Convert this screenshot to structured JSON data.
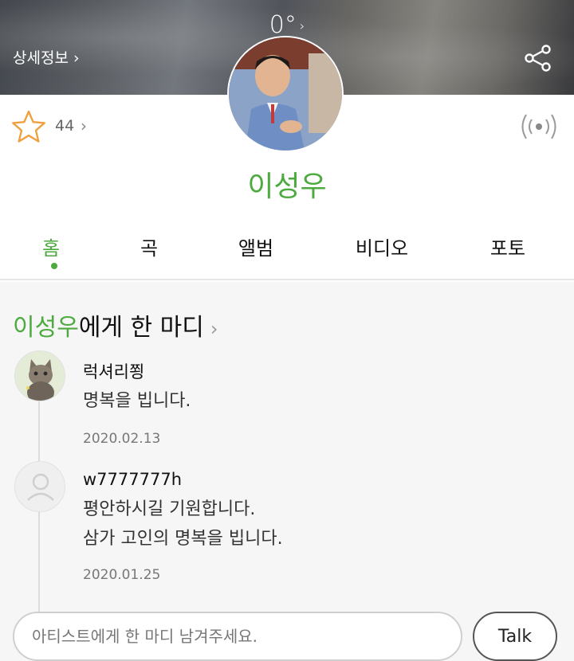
{
  "header": {
    "temperature": "0°",
    "temperature_chevron": "›",
    "detail_link": "상세정보 ›",
    "share_icon": "share-icon"
  },
  "artist": {
    "name": "이성우",
    "like_count": "44",
    "like_chevron": "›"
  },
  "tabs": [
    {
      "label": "홈",
      "active": true
    },
    {
      "label": "곡",
      "active": false
    },
    {
      "label": "앨범",
      "active": false
    },
    {
      "label": "비디오",
      "active": false
    },
    {
      "label": "포토",
      "active": false
    }
  ],
  "comments_section": {
    "title_name": "이성우",
    "title_suffix": "에게 한 마디",
    "chevron": "›"
  },
  "comments": [
    {
      "user": "럭셔리쬥",
      "lines": [
        "명복을 빕니다."
      ],
      "date": "2020.02.13"
    },
    {
      "user": "w7777777h",
      "lines": [
        "평안하시길 기원합니다.",
        "삼가 고인의 명복을 빕니다."
      ],
      "date": "2020.01.25"
    }
  ],
  "input": {
    "placeholder": "아티스트에게 한 마디 남겨주세요.",
    "talk_label": "Talk"
  },
  "colors": {
    "accent": "#4caa3f",
    "star": "#f0a040"
  }
}
